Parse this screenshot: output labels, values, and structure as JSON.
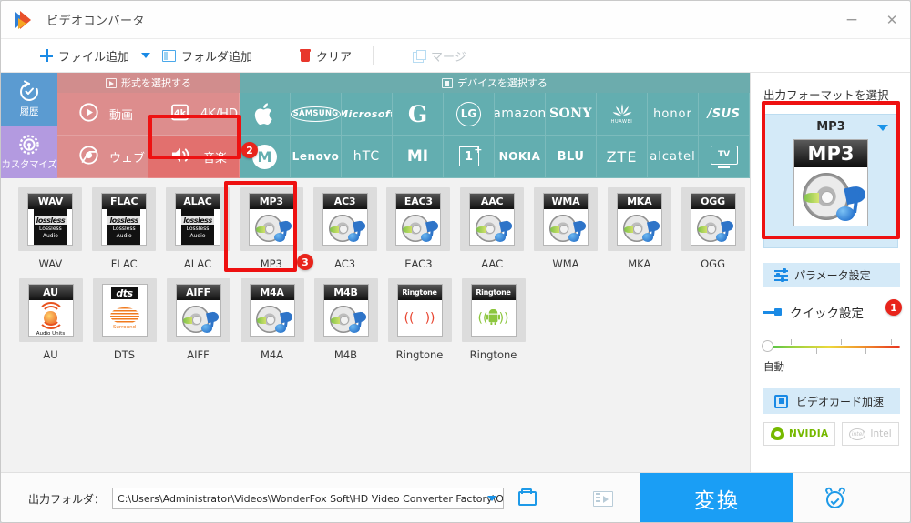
{
  "window": {
    "title": "ビデオコンバータ",
    "logo_icon": "video-converter-logo-icon",
    "minimize_label": "−",
    "close_label": "✕"
  },
  "toolbar": {
    "add_file": "ファイル追加",
    "add_file_icon": "plus-icon",
    "add_file_dropdown_icon": "chevron-down-icon",
    "add_folder": "フォルダ追加",
    "add_folder_icon": "folder-icon",
    "clear": "クリア",
    "clear_icon": "trash-icon",
    "merge": "マージ",
    "merge_icon": "merge-icon"
  },
  "side_tabs": [
    {
      "label": "履歴",
      "icon": "history-icon",
      "color": "#5b9bd1"
    },
    {
      "label": "カスタマイズ",
      "icon": "gear-icon",
      "color": "#b39ae0"
    }
  ],
  "format_header": {
    "label": "形式を選択する",
    "icon": "format-icon",
    "color": "#d18d8d"
  },
  "device_header": {
    "label": "デバイスを選択する",
    "icon": "device-icon",
    "color": "#6cacad"
  },
  "categories": [
    {
      "label": "動画",
      "icon": "play-icon",
      "active": false
    },
    {
      "label": "4K/HD",
      "icon": "4k-icon",
      "active": false
    },
    {
      "label": "ウェブ",
      "icon": "chrome-icon",
      "active": false
    },
    {
      "label": "音楽",
      "icon": "speaker-icon",
      "active": true
    }
  ],
  "devices": [
    {
      "name": "Apple",
      "glyph": "",
      "style": "glyph"
    },
    {
      "name": "SAMSUNG",
      "glyph": "SAMSUNG",
      "style": "oval"
    },
    {
      "name": "Microsoft",
      "glyph": "Microsoft",
      "style": "bold-italic"
    },
    {
      "name": "Google",
      "glyph": "G",
      "style": "big"
    },
    {
      "name": "LG",
      "glyph": "LG",
      "style": "circle"
    },
    {
      "name": "amazon",
      "glyph": "amazon",
      "style": "lower"
    },
    {
      "name": "SONY",
      "glyph": "SONY",
      "style": "serif"
    },
    {
      "name": "HUAWEI",
      "glyph": "HUAWEI",
      "style": "flower"
    },
    {
      "name": "honor",
      "glyph": "honor",
      "style": "lower"
    },
    {
      "name": "ASUS",
      "glyph": "/SUS",
      "style": "bold"
    },
    {
      "name": "Motorola",
      "glyph": "M",
      "style": "circle"
    },
    {
      "name": "Lenovo",
      "glyph": "Lenovo",
      "style": "bold"
    },
    {
      "name": "HTC",
      "glyph": "hTC",
      "style": "thin"
    },
    {
      "name": "Xiaomi",
      "glyph": "MI",
      "style": "bold"
    },
    {
      "name": "OnePlus",
      "glyph": "1",
      "style": "box"
    },
    {
      "name": "NOKIA",
      "glyph": "NOKIA",
      "style": "bold"
    },
    {
      "name": "BLU",
      "glyph": "BLU",
      "style": "bold"
    },
    {
      "name": "ZTE",
      "glyph": "ZTE",
      "style": "bold"
    },
    {
      "name": "alcatel",
      "glyph": "alcatel",
      "style": "lower"
    },
    {
      "name": "TV",
      "glyph": "TV",
      "style": "tv"
    }
  ],
  "formats": {
    "row1": [
      {
        "label": "WAV",
        "cap": "WAV",
        "art": "lossless",
        "selected": false
      },
      {
        "label": "FLAC",
        "cap": "FLAC",
        "art": "lossless",
        "selected": false
      },
      {
        "label": "ALAC",
        "cap": "ALAC",
        "art": "lossless",
        "selected": false
      },
      {
        "label": "MP3",
        "cap": "MP3",
        "art": "cd",
        "selected": true
      },
      {
        "label": "AC3",
        "cap": "AC3",
        "art": "cd",
        "selected": false
      },
      {
        "label": "EAC3",
        "cap": "EAC3",
        "art": "cd",
        "selected": false
      },
      {
        "label": "AAC",
        "cap": "AAC",
        "art": "cd",
        "selected": false
      },
      {
        "label": "WMA",
        "cap": "WMA",
        "art": "cd",
        "selected": false
      },
      {
        "label": "MKA",
        "cap": "MKA",
        "art": "cd",
        "selected": false
      },
      {
        "label": "OGG",
        "cap": "OGG",
        "art": "cd",
        "selected": false
      }
    ],
    "row2": [
      {
        "label": "AU",
        "cap": "AU",
        "art": "au",
        "selected": false
      },
      {
        "label": "DTS",
        "cap": "dts",
        "art": "dts",
        "selected": false
      },
      {
        "label": "AIFF",
        "cap": "AIFF",
        "art": "cd",
        "selected": false
      },
      {
        "label": "M4A",
        "cap": "M4A",
        "art": "cd",
        "selected": false
      },
      {
        "label": "M4B",
        "cap": "M4B",
        "art": "cd",
        "selected": false
      },
      {
        "label": "Ringtone",
        "cap": "Ringtone",
        "art": "apple",
        "selected": false
      },
      {
        "label": "Ringtone",
        "cap": "Ringtone",
        "art": "android",
        "selected": false
      }
    ],
    "lossless_word": "lossless",
    "lossless_line1": "Lossless",
    "lossless_line2": "Audio",
    "au_label": "Audio Units",
    "dts_sub": "Surround"
  },
  "badges": {
    "step1": "1",
    "step2": "2",
    "step3": "3",
    "color": "#e8241b"
  },
  "right_panel": {
    "title": "出力フォーマットを選択",
    "selected_format": "MP3",
    "dropdown_icon": "chevron-down-icon",
    "param_settings": "パラメータ設定",
    "param_icon": "sliders-icon",
    "quick_settings": "クイック設定",
    "quick_icon": "quick-icon",
    "slider_value_label": "自動",
    "gpu_accel": "ビデオカード加速",
    "gpu_icon": "chip-icon",
    "nvidia": "NVIDIA",
    "nvidia_icon": "nvidia-eye-icon",
    "intel": "Intel",
    "intel_icon": "intel-icon"
  },
  "bottom": {
    "output_label": "出力フォルダ：",
    "output_path": "C:\\Users\\Administrator\\Videos\\WonderFox Soft\\HD Video Converter Factory\\OutputVideo\\",
    "dropdown_icon": "chevron-down-icon",
    "open_folder_icon": "open-folder-icon",
    "preview_icon": "film-preview-icon",
    "convert_label": "変換",
    "timer_icon": "alarm-clock-icon"
  }
}
